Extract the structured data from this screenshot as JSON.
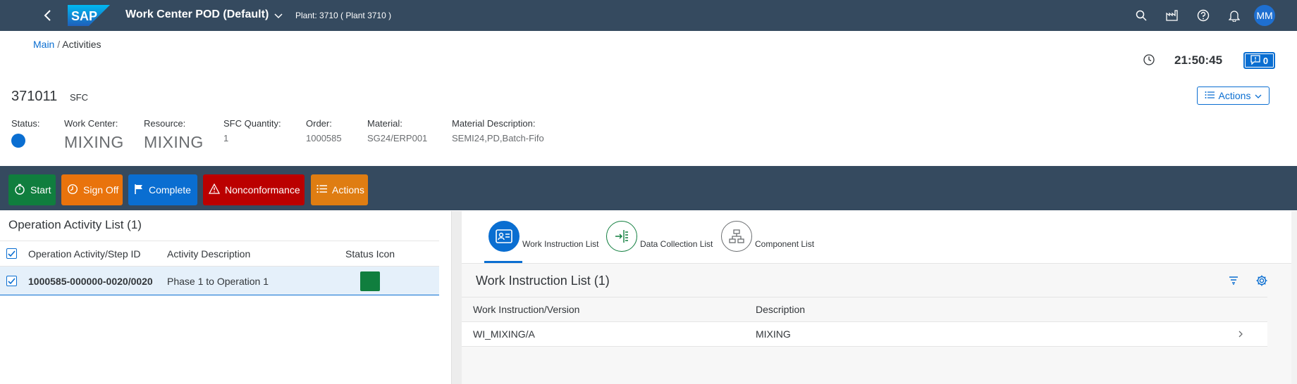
{
  "shell": {
    "logo_text": "SAP",
    "app_title": "Work Center POD (Default)",
    "plant": "Plant: 3710 ( Plant 3710 )",
    "avatar": "MM",
    "icons": [
      "search-icon",
      "factory-icon",
      "help-icon",
      "bell-icon"
    ]
  },
  "breadcrumb": {
    "link": "Main",
    "separator": "/",
    "current": "Activities"
  },
  "header": {
    "time": "21:50:45",
    "notifications": "0",
    "sfc_number": "371011",
    "sfc_label": "SFC",
    "actions_label": "Actions"
  },
  "fields": {
    "status_label": "Status:",
    "status_color": "#0a6ed1",
    "work_center_label": "Work Center:",
    "work_center_value": "MIXING",
    "resource_label": "Resource:",
    "resource_value": "MIXING",
    "qty_label": "SFC Quantity:",
    "qty_value": "1",
    "order_label": "Order:",
    "order_value": "1000585",
    "material_label": "Material:",
    "material_value": "SG24/ERP001",
    "desc_label": "Material Description:",
    "desc_value": "SEMI24,PD,Batch-Fifo"
  },
  "toolbar": {
    "start": "Start",
    "sign_off": "Sign Off",
    "complete": "Complete",
    "nonconformance": "Nonconformance",
    "actions": "Actions",
    "colors": {
      "start": "#107e3e",
      "sign_off": "#e9730c",
      "complete": "#0a6ed1",
      "nonconformance": "#bb0000",
      "actions": "#df7d12"
    }
  },
  "left": {
    "title": "Operation Activity List (1)",
    "columns": [
      "Operation Activity/Step ID",
      "Activity Description",
      "Status Icon"
    ],
    "rows": [
      {
        "id": "1000585-000000-0020/0020",
        "description": "Phase 1 to Operation 1",
        "status_color": "#107e3e"
      }
    ]
  },
  "right": {
    "tabs": [
      {
        "label": "Work Instruction List",
        "active": true
      },
      {
        "label": "Data Collection List",
        "active": false
      },
      {
        "label": "Component List",
        "active": false
      }
    ],
    "title": "Work Instruction List (1)",
    "columns": [
      "Work Instruction/Version",
      "Description"
    ],
    "rows": [
      {
        "version": "WI_MIXING/A",
        "description": "MIXING"
      }
    ]
  }
}
